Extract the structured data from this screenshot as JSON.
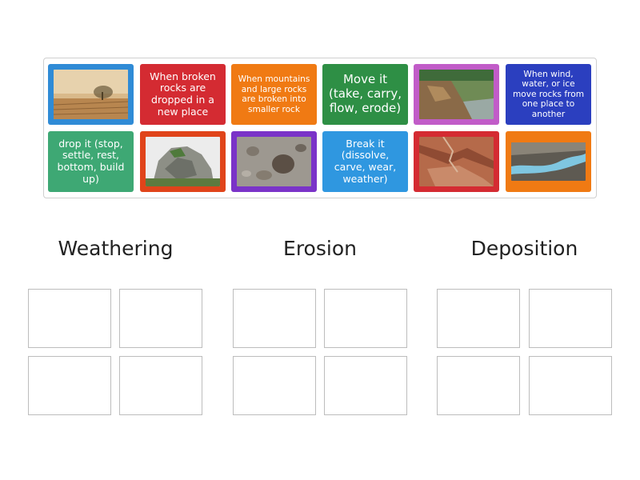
{
  "tiles": {
    "t2": "When broken rocks are dropped in a new place",
    "t3": "When mountains and large rocks are broken into smaller rock",
    "t4": "Move it (take, carry, flow, erode)",
    "t6": "When wind, water, or ice move rocks from one place to another",
    "t7": "drop it (stop, settle, rest, bottom, build up)",
    "t10": "Break it (dissolve, carve, wear, weather)"
  },
  "images": {
    "t1": "dusty-field-image",
    "t5": "eroded-riverbank-image",
    "t8": "rocky-outcrop-image",
    "t9": "rubble-rocks-image",
    "t11": "red-canyon-delta-image",
    "t12": "glacial-river-image"
  },
  "colors": {
    "blue": "#2f8bd6",
    "red": "#d42b32",
    "orange": "#f07a13",
    "green": "#2e8f45",
    "purple": "#c15cc8",
    "indigo": "#2b3fbf",
    "teal": "#3ea874",
    "violet": "#7a33c8",
    "lightblue": "#2f97e0"
  },
  "categories": {
    "weathering": "Weathering",
    "erosion": "Erosion",
    "deposition": "Deposition"
  }
}
